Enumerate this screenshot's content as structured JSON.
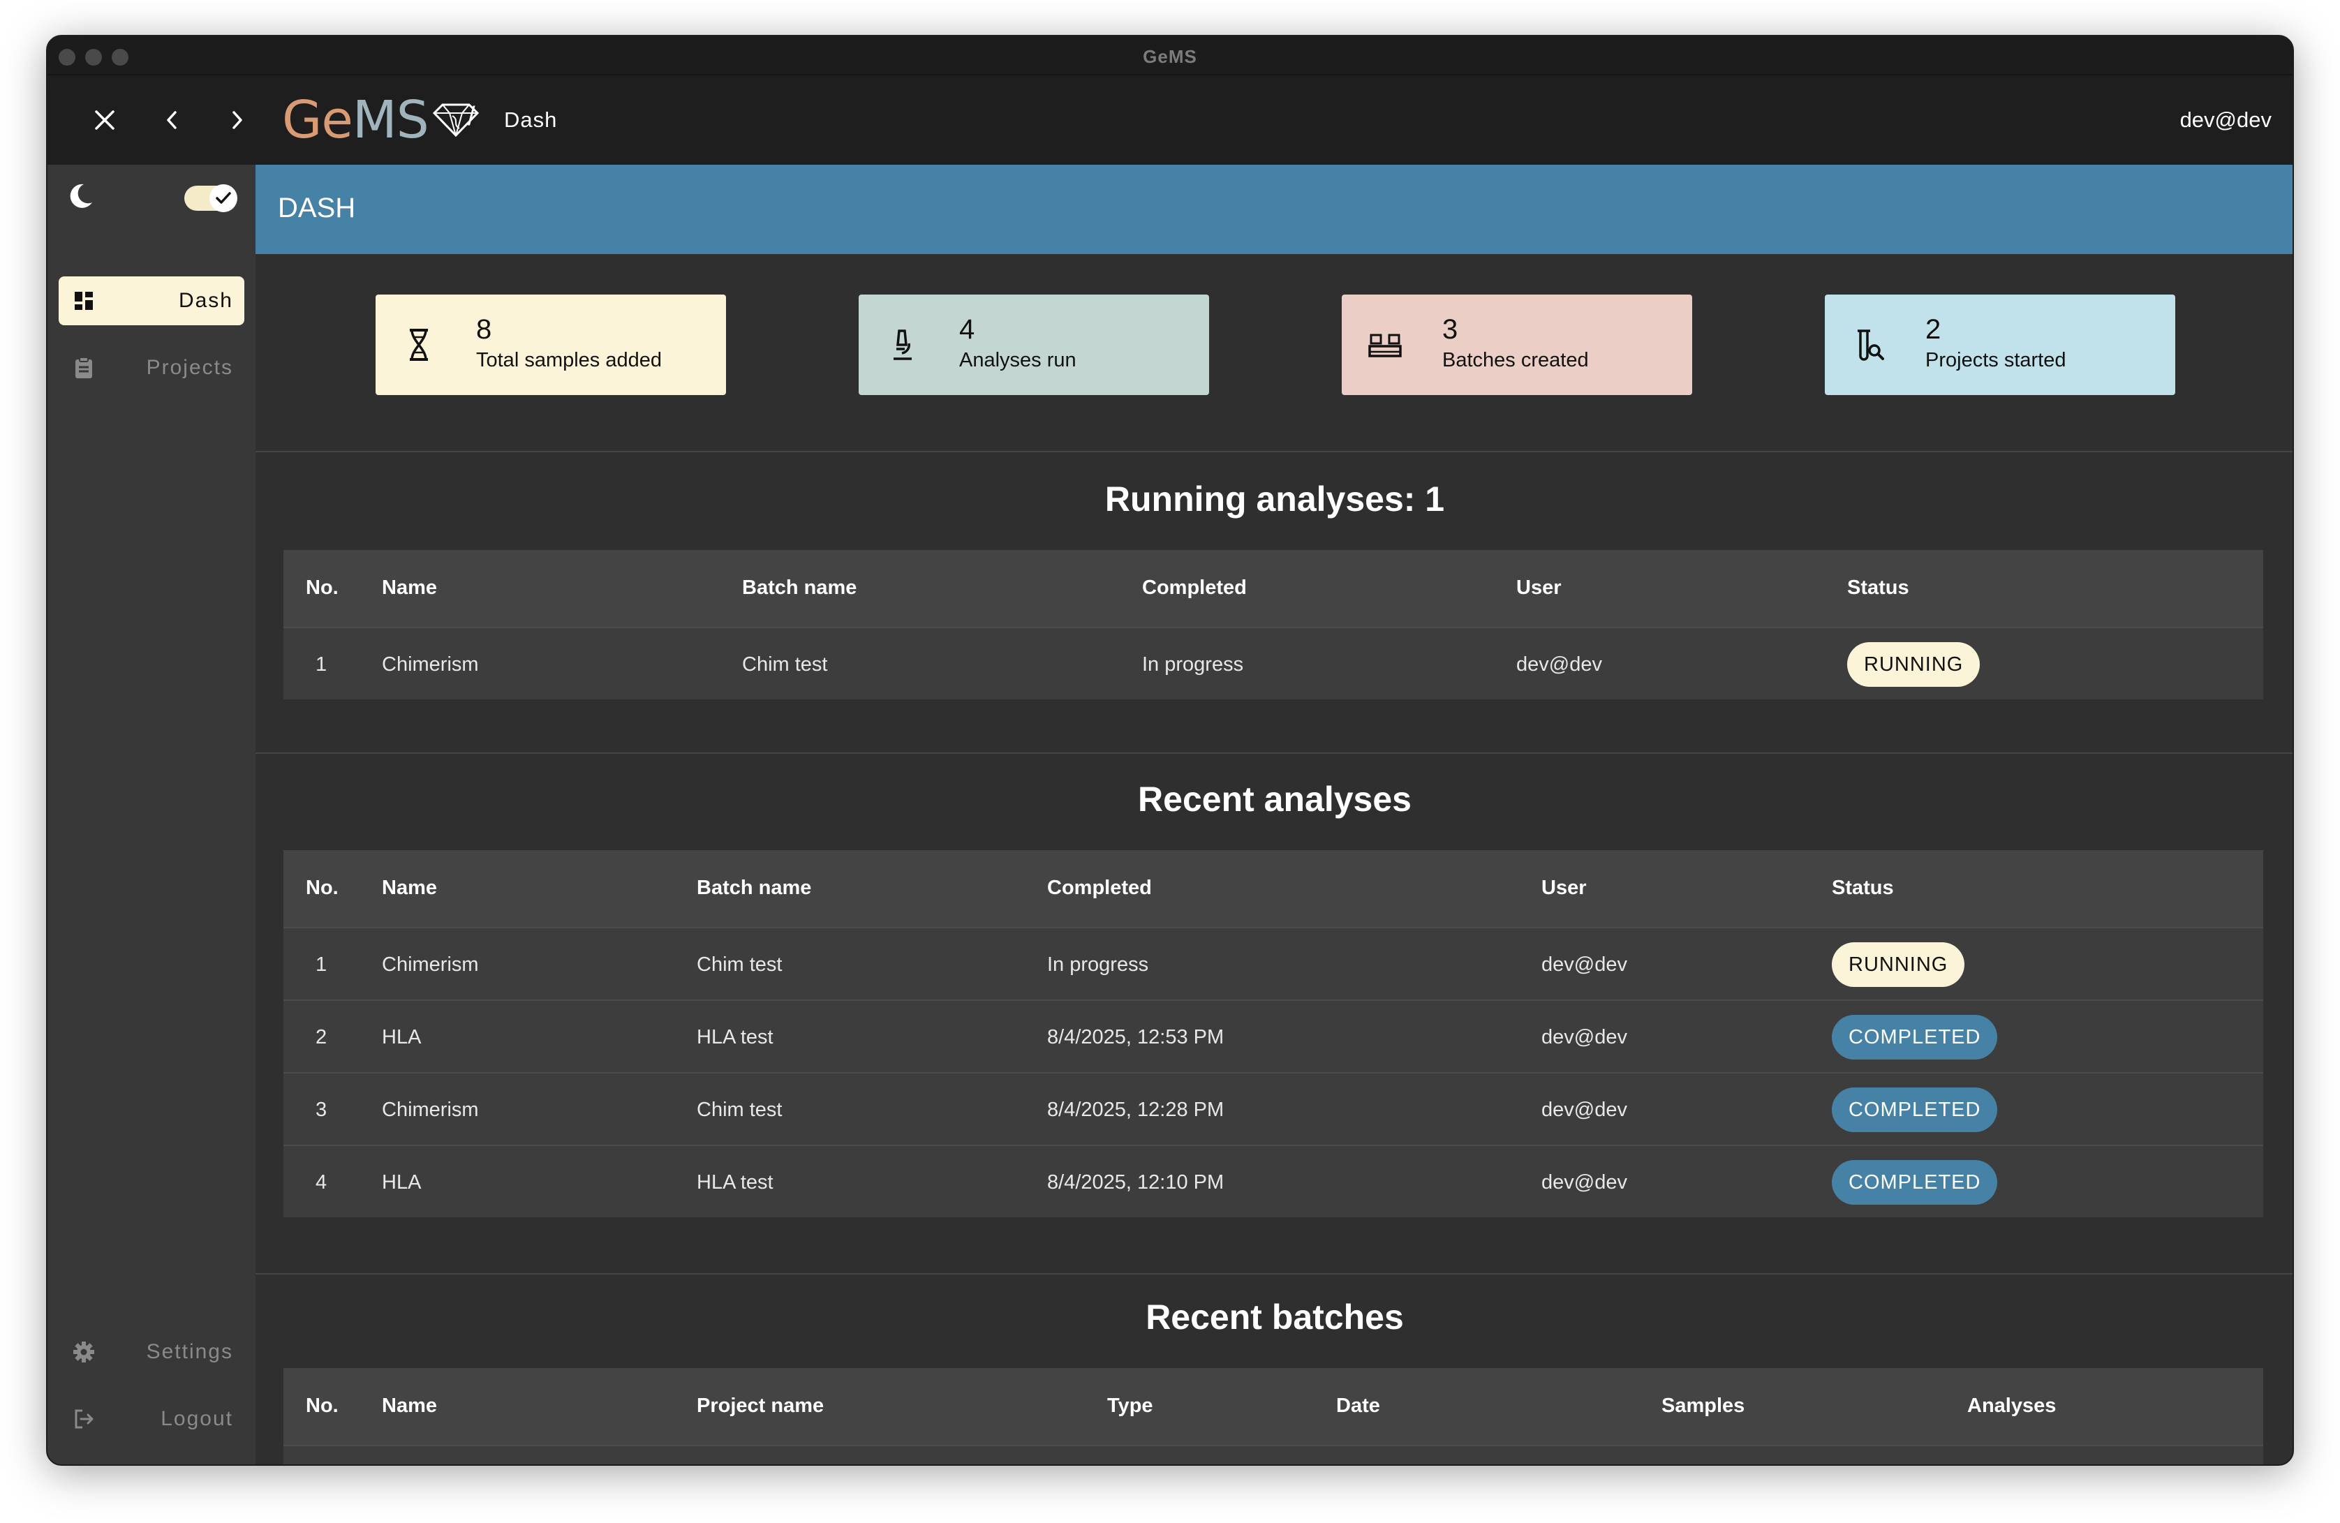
{
  "window": {
    "title": "GeMS"
  },
  "topbar": {
    "breadcrumb_sep": "/",
    "breadcrumb": "Dash",
    "user": "dev@dev",
    "logo_ge": "Ge",
    "logo_ms": "MS"
  },
  "sidebar": {
    "items": [
      {
        "label": "Dash",
        "icon": "dashboard-icon",
        "active": true
      },
      {
        "label": "Projects",
        "icon": "clipboard-icon",
        "active": false
      },
      {
        "label": "Settings",
        "icon": "gear-icon",
        "active": false
      },
      {
        "label": "Logout",
        "icon": "logout-icon",
        "active": false
      }
    ],
    "dark_mode": true
  },
  "main": {
    "header": "DASH",
    "cards": [
      {
        "value": "8",
        "label": "Total samples added",
        "icon": "hourglass-dna-icon",
        "color": "#fcf4d9"
      },
      {
        "value": "4",
        "label": "Analyses run",
        "icon": "microscope-icon",
        "color": "#c4d6d2"
      },
      {
        "value": "3",
        "label": "Batches created",
        "icon": "rack-icon",
        "color": "#ebcfc6"
      },
      {
        "value": "2",
        "label": "Projects started",
        "icon": "flask-search-icon",
        "color": "#c1e2ea"
      }
    ],
    "running": {
      "title": "Running analyses: 1",
      "columns": [
        "No.",
        "Name",
        "Batch name",
        "Completed",
        "User",
        "Status"
      ],
      "rows": [
        {
          "no": "1",
          "name": "Chimerism",
          "batch": "Chim test",
          "completed": "In progress",
          "user": "dev@dev",
          "status": "RUNNING"
        }
      ]
    },
    "recent": {
      "title": "Recent analyses",
      "columns": [
        "No.",
        "Name",
        "Batch name",
        "Completed",
        "User",
        "Status"
      ],
      "rows": [
        {
          "no": "1",
          "name": "Chimerism",
          "batch": "Chim test",
          "completed": "In progress",
          "user": "dev@dev",
          "status": "RUNNING"
        },
        {
          "no": "2",
          "name": "HLA",
          "batch": "HLA test",
          "completed": "8/4/2025, 12:53 PM",
          "user": "dev@dev",
          "status": "COMPLETED"
        },
        {
          "no": "3",
          "name": "Chimerism",
          "batch": "Chim test",
          "completed": "8/4/2025, 12:28 PM",
          "user": "dev@dev",
          "status": "COMPLETED"
        },
        {
          "no": "4",
          "name": "HLA",
          "batch": "HLA test",
          "completed": "8/4/2025, 12:10 PM",
          "user": "dev@dev",
          "status": "COMPLETED"
        }
      ]
    },
    "batches": {
      "title": "Recent batches",
      "columns": [
        "No.",
        "Name",
        "Project name",
        "Type",
        "Date",
        "Samples",
        "Analyses"
      ]
    }
  }
}
